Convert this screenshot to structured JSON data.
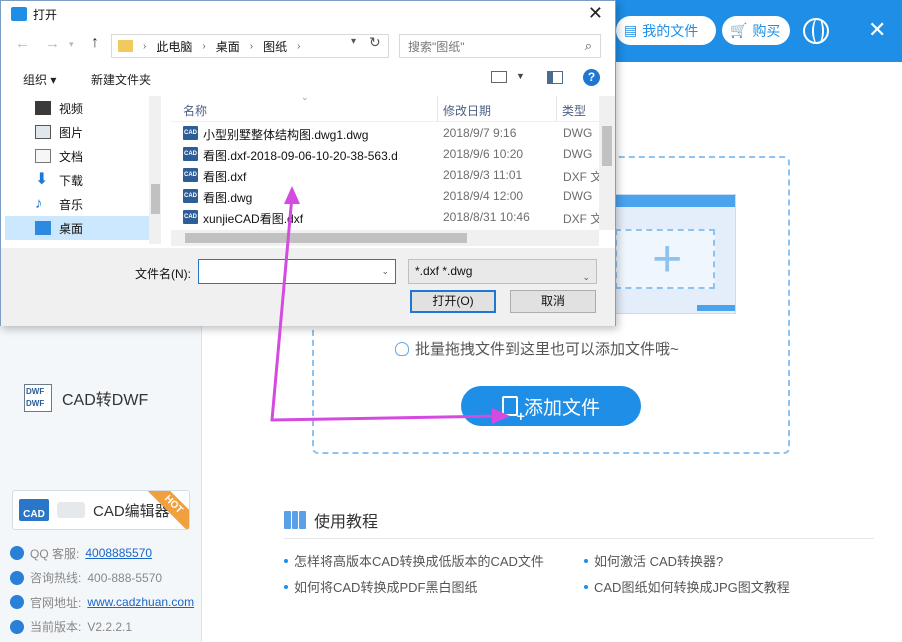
{
  "app": {
    "header": {
      "my_files": "我的文件",
      "buy": "购买"
    },
    "left": {
      "dwf_label": "CAD转DWF",
      "editor_label": "CAD编辑器",
      "hot_badge": "HOT",
      "info": [
        {
          "label": "QQ 客服:",
          "value": "4008885570",
          "link": true
        },
        {
          "label": "咨询热线:",
          "value": "400-888-5570",
          "link": false
        },
        {
          "label": "官网地址:",
          "value": "www.cadzhuan.com",
          "link": true
        },
        {
          "label": "当前版本:",
          "value": "V2.2.2.1",
          "link": false
        }
      ]
    },
    "drop_zone": {
      "hint": "批量拖拽文件到这里也可以添加文件哦~",
      "add_button": "添加文件"
    },
    "tutorial": {
      "title": "使用教程",
      "links": [
        "怎样将高版本CAD转换成低版本的CAD文件",
        "如何激活 CAD转换器?",
        "如何将CAD转换成PDF黑白图纸",
        "CAD图纸如何转换成JPG图文教程"
      ]
    },
    "colors": {
      "brand_blue": "#1e8ee6",
      "annotation_arrow": "#d44be0"
    }
  },
  "dialog": {
    "title": "打开",
    "breadcrumb": [
      "此电脑",
      "桌面",
      "图纸"
    ],
    "search_placeholder": "搜索\"图纸\"",
    "toolbar": {
      "organize": "组织 ▾",
      "new_folder": "新建文件夹"
    },
    "nav_items": [
      {
        "label": "视频",
        "icon": "video-folder-icon"
      },
      {
        "label": "图片",
        "icon": "pictures-folder-icon"
      },
      {
        "label": "文档",
        "icon": "documents-folder-icon"
      },
      {
        "label": "下载",
        "icon": "download-folder-icon"
      },
      {
        "label": "音乐",
        "icon": "music-folder-icon"
      },
      {
        "label": "桌面",
        "icon": "desktop-folder-icon",
        "selected": true
      }
    ],
    "columns": {
      "name": "名称",
      "date": "修改日期",
      "type": "类型"
    },
    "files": [
      {
        "name": "小型别墅整体结构图.dwg1.dwg",
        "date": "2018/9/7 9:16",
        "type": "DWG"
      },
      {
        "name": "看图.dxf-2018-09-06-10-20-38-563.d",
        "date": "2018/9/6 10:20",
        "type": "DWG"
      },
      {
        "name": "看图.dxf",
        "date": "2018/9/3 11:01",
        "type": "DXF 文"
      },
      {
        "name": "看图.dwg",
        "date": "2018/9/4 12:00",
        "type": "DWG"
      },
      {
        "name": "xunjieCAD看图.dxf",
        "date": "2018/8/31 10:46",
        "type": "DXF 文"
      }
    ],
    "filename_label": "文件名(N):",
    "filename_value": "",
    "filter": "*.dxf *.dwg",
    "open_button": "打开(O)",
    "cancel_button": "取消"
  }
}
